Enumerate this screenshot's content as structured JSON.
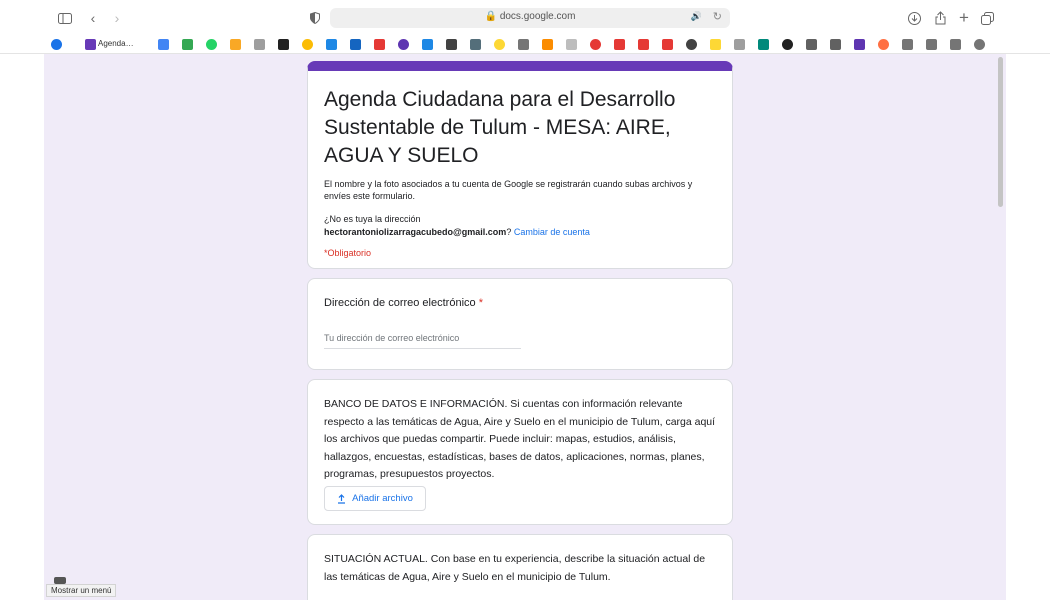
{
  "browser": {
    "url": "docs.google.com",
    "bookmark_label": "Agenda…",
    "status_text": "Mostrar un menú"
  },
  "form": {
    "title": "Agenda Ciudadana para el Desarrollo Sustentable de Tulum - MESA: AIRE, AGUA Y SUELO",
    "account_notice": "El nombre y la foto asociados a tu cuenta de Google se registrarán cuando subas archivos y envíes este formulario.",
    "not_you": "¿No es tuya la dirección",
    "email": "hectorantoniolizarragacubedo@gmail.com",
    "switch_account": "Cambiar de cuenta",
    "required_note": "*Obligatorio"
  },
  "questions": {
    "email_label": "Dirección de correo electrónico",
    "email_placeholder": "Tu dirección de correo electrónico",
    "bank_text": "BANCO DE DATOS E INFORMACIÓN. Si cuentas con información relevante respecto a las temáticas de Agua, Aire y Suelo en el municipio de Tulum, carga aquí los archivos que puedas compartir. Puede incluir: mapas, estudios, análisis, hallazgos, encuestas, estadísticas, bases de datos, aplicaciones, normas, planes, programas, presupuestos proyectos.",
    "upload_label": "Añadir archivo",
    "situation_text": "SITUACIÓN ACTUAL. Con base en tu experiencia, describe la situación actual de las temáticas de Agua, Aire y Suelo en el municipio de Tulum."
  },
  "colors": {
    "accent": "#673ab7",
    "background": "#f0ebf8",
    "link": "#1a73e8",
    "required": "#d93025"
  }
}
